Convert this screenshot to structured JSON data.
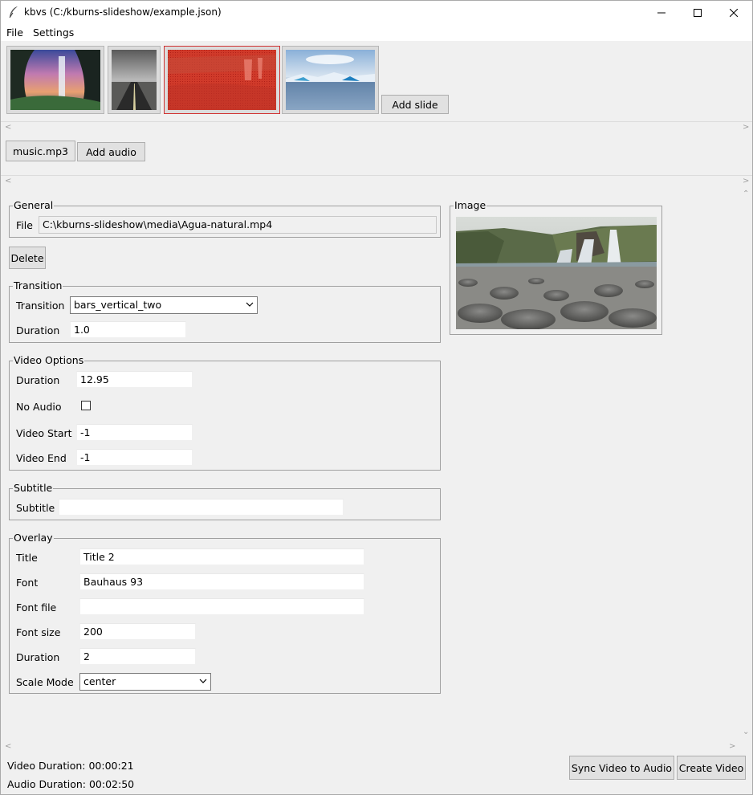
{
  "window": {
    "title": "kbvs (C:/kburns-slideshow/example.json)",
    "icons": [
      "feather-icon",
      "minimize-icon",
      "maximize-icon",
      "close-icon"
    ]
  },
  "menu": {
    "file": "File",
    "settings": "Settings"
  },
  "slides": {
    "items": [
      {
        "name": "waterfall-cave-thumbnail"
      },
      {
        "name": "road-thumbnail"
      },
      {
        "name": "waterfall-video-thumbnail-selected"
      },
      {
        "name": "glacier-lagoon-thumbnail"
      }
    ],
    "add_label": "Add slide",
    "selected_index": 2,
    "selected_color": "#d03030"
  },
  "audio": {
    "items": [
      "music.mp3"
    ],
    "add_label": "Add audio"
  },
  "general": {
    "legend": "General",
    "file_label": "File",
    "file_value": "C:\\kburns-slideshow\\media\\Agua-natural.mp4"
  },
  "delete_label": "Delete",
  "transition": {
    "legend": "Transition",
    "transition_label": "Transition",
    "transition_value": "bars_vertical_two",
    "duration_label": "Duration",
    "duration_value": "1.0"
  },
  "video_options": {
    "legend": "Video Options",
    "duration_label": "Duration",
    "duration_value": "12.95",
    "no_audio_label": "No Audio",
    "no_audio_checked": false,
    "video_start_label": "Video Start",
    "video_start_value": "-1",
    "video_end_label": "Video End",
    "video_end_value": "-1"
  },
  "subtitle": {
    "legend": "Subtitle",
    "label": "Subtitle",
    "value": ""
  },
  "overlay": {
    "legend": "Overlay",
    "title_label": "Title",
    "title_value": "Title 2",
    "font_label": "Font",
    "font_value": "Bauhaus 93",
    "font_file_label": "Font file",
    "font_file_value": "",
    "font_size_label": "Font size",
    "font_size_value": "200",
    "duration_label": "Duration",
    "duration_value": "2",
    "scale_mode_label": "Scale Mode",
    "scale_mode_value": "center"
  },
  "image_panel": {
    "legend": "Image"
  },
  "status": {
    "video_duration": "Video Duration: 00:00:21",
    "audio_duration": "Audio Duration: 00:02:50"
  },
  "actions": {
    "sync_label": "Sync Video to Audio",
    "create_label": "Create Video"
  }
}
